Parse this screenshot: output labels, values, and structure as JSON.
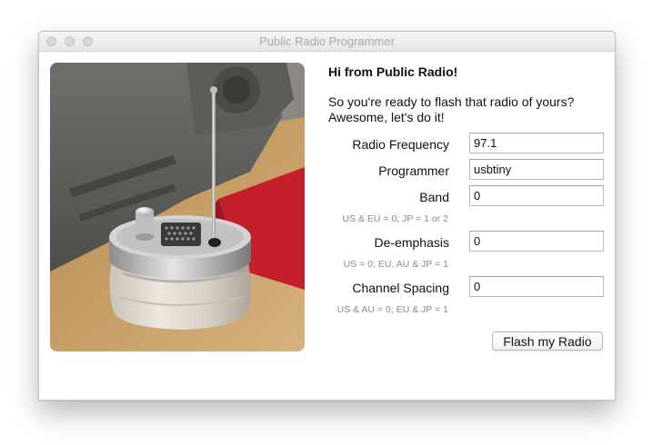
{
  "window": {
    "title": "Public Radio Programmer"
  },
  "content": {
    "greeting": "Hi from Public Radio!",
    "intro_line1": "So you're ready to flash that radio of yours?",
    "intro_line2": "Awesome, let's do it!"
  },
  "fields": {
    "frequency": {
      "label": "Radio Frequency",
      "value": "97.1"
    },
    "programmer": {
      "label": "Programmer",
      "value": "usbtiny"
    },
    "band": {
      "label": "Band",
      "value": "0",
      "hint": "US & EU = 0; JP = 1 or 2"
    },
    "deemphasis": {
      "label": "De-emphasis",
      "value": "0",
      "hint": "US = 0; EU, AU & JP = 1"
    },
    "spacing": {
      "label": "Channel Spacing",
      "value": "0",
      "hint": "US & AU = 0; EU & JP = 1"
    }
  },
  "actions": {
    "flash_label": "Flash my Radio"
  }
}
